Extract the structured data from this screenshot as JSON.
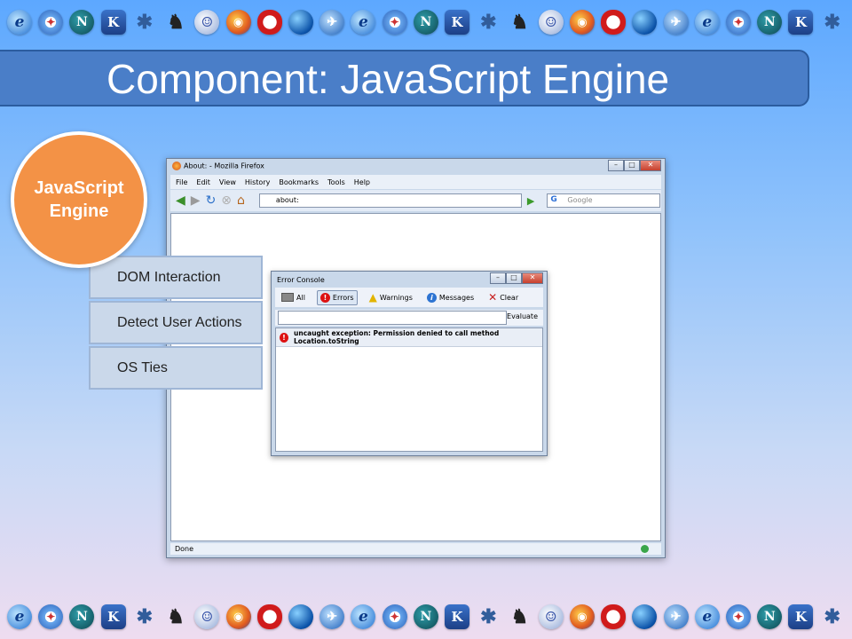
{
  "slide": {
    "title": "Component: JavaScript Engine",
    "main_component": "JavaScript Engine",
    "subcomponents": [
      "DOM Interaction",
      "Detect User Actions",
      "OS Ties"
    ],
    "icons_top": [
      "ie",
      "safari",
      "netscape",
      "konqueror",
      "kde",
      "gnu",
      "epiphany",
      "firefox",
      "opera",
      "globe",
      "kmeleon",
      "ie",
      "safari",
      "netscape",
      "konqueror",
      "kde",
      "gnu",
      "epiphany",
      "firefox",
      "opera",
      "globe",
      "kmeleon",
      "ie",
      "safari",
      "netscape",
      "konqueror",
      "kde"
    ],
    "icons_bottom": [
      "ie",
      "safari",
      "netscape",
      "konqueror",
      "kde",
      "gnu",
      "epiphany",
      "firefox",
      "opera",
      "globe",
      "kmeleon",
      "ie",
      "safari",
      "netscape",
      "konqueror",
      "kde",
      "gnu",
      "epiphany",
      "firefox",
      "opera",
      "globe",
      "kmeleon",
      "ie",
      "safari",
      "netscape",
      "konqueror",
      "kde"
    ]
  },
  "browser": {
    "window_title": "About: - Mozilla Firefox",
    "menu": [
      "File",
      "Edit",
      "View",
      "History",
      "Bookmarks",
      "Tools",
      "Help"
    ],
    "url": "about:",
    "search_placeholder": "Google",
    "status": "Done"
  },
  "console": {
    "title": "Error Console",
    "toolbar": {
      "all": "All",
      "errors": "Errors",
      "warnings": "Warnings",
      "messages": "Messages",
      "clear": "Clear"
    },
    "evaluate_label": "Evaluate",
    "error_message": "uncaught exception: Permission denied to call method Location.toString"
  },
  "colors": {
    "title_bar": "#4a7ec8",
    "engine_circle": "#f39246",
    "sub_box": "#cad8ea"
  }
}
